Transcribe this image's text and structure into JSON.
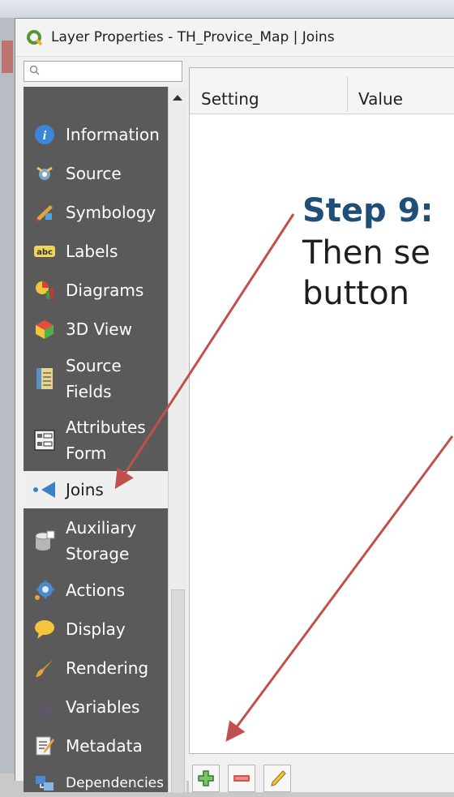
{
  "window": {
    "title": "Layer Properties - TH_Provice_Map | Joins"
  },
  "search": {
    "placeholder": ""
  },
  "sidebar": {
    "items": [
      {
        "label": "Information",
        "icon": "info-icon",
        "active": false
      },
      {
        "label": "Source",
        "icon": "source-icon",
        "active": false
      },
      {
        "label": "Symbology",
        "icon": "symbology-icon",
        "active": false
      },
      {
        "label": "Labels",
        "icon": "labels-icon",
        "active": false
      },
      {
        "label": "Diagrams",
        "icon": "diagrams-icon",
        "active": false
      },
      {
        "label": "3D View",
        "icon": "cube-icon",
        "active": false
      },
      {
        "label": "Source Fields",
        "icon": "fields-icon",
        "active": false
      },
      {
        "label": "Attributes Form",
        "icon": "form-icon",
        "active": false
      },
      {
        "label": "Joins",
        "icon": "joins-icon",
        "active": true
      },
      {
        "label": "Auxiliary Storage",
        "icon": "database-icon",
        "active": false
      },
      {
        "label": "Actions",
        "icon": "gear-icon",
        "active": false
      },
      {
        "label": "Display",
        "icon": "speech-bubble-icon",
        "active": false
      },
      {
        "label": "Rendering",
        "icon": "brush-icon",
        "active": false
      },
      {
        "label": "Variables",
        "icon": "variables-icon",
        "active": false
      },
      {
        "label": "Metadata",
        "icon": "metadata-icon",
        "active": false
      },
      {
        "label": "Dependencies",
        "icon": "dependencies-icon",
        "active": false
      }
    ]
  },
  "table": {
    "columns": [
      "Setting",
      "Value"
    ]
  },
  "annotation": {
    "title": "Step 9:",
    "lines": [
      "Then se",
      "button"
    ]
  },
  "toolbar": {
    "buttons": [
      {
        "icon": "plus-icon"
      },
      {
        "icon": "minus-icon"
      },
      {
        "icon": "pencil-icon"
      }
    ]
  },
  "colors": {
    "sidebar_bg": "#5a5a5a",
    "step_title": "#1f4e79",
    "arrow": "#c0504d"
  }
}
